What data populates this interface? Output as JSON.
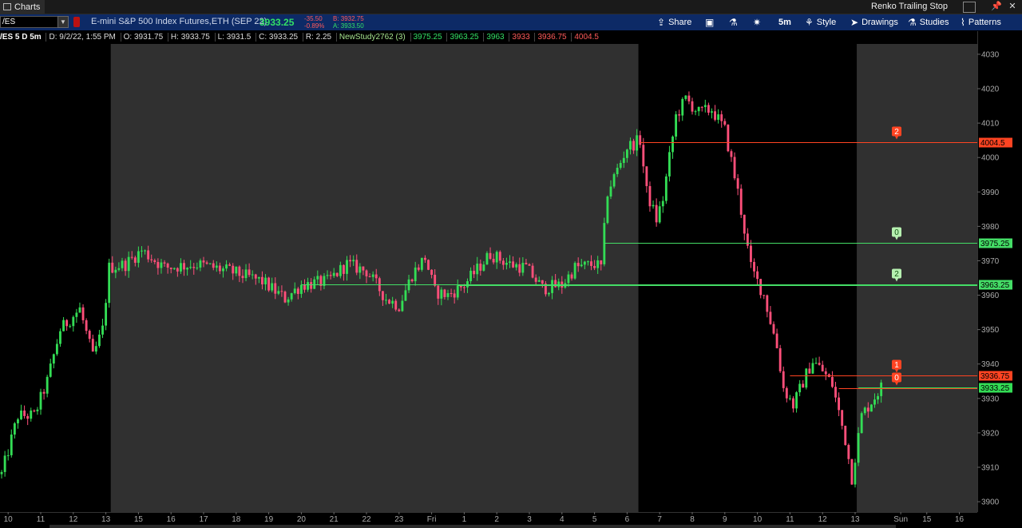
{
  "window": {
    "tab_label": "Charts",
    "right_title": "Renko Trailing Stop"
  },
  "toolbar": {
    "symbol": "/ES",
    "instrument_name": "E-mini S&P 500 Index Futures,ETH (SEP 22)",
    "last_price": "3933.25",
    "change": "-35.50",
    "change_pct": "-0.89%",
    "bid": "B: 3932.75",
    "ask": "A: 3933.50",
    "share_label": "Share",
    "timeframe_label": "5m",
    "style_label": "Style",
    "drawings_label": "Drawings",
    "studies_label": "Studies",
    "patterns_label": "Patterns"
  },
  "infobar": {
    "symbol_period": "/ES 5 D 5m",
    "date": "D: 9/2/22, 1:55 PM",
    "open": "O: 3931.75",
    "high": "H: 3933.75",
    "low": "L: 3931.5",
    "close": "C: 3933.25",
    "range": "R: 2.25",
    "study_name": "NewStudy2762 (3)",
    "study_values": [
      "3975.25",
      "3963.25",
      "3963",
      "3933",
      "3936.75",
      "4004.5"
    ]
  },
  "chart_data": {
    "type": "candlestick",
    "ylim": [
      3897,
      4033
    ],
    "y_ticks": [
      3900,
      3910,
      3920,
      3930,
      3940,
      3950,
      3960,
      3970,
      3980,
      3990,
      4000,
      4010,
      4020,
      4030
    ],
    "x_tick_labels": [
      {
        "label": "10",
        "i": 2
      },
      {
        "label": "11",
        "i": 12
      },
      {
        "label": "12",
        "i": 22
      },
      {
        "label": "13",
        "i": 32
      },
      {
        "label": "15",
        "i": 42
      },
      {
        "label": "16",
        "i": 52
      },
      {
        "label": "17",
        "i": 62
      },
      {
        "label": "18",
        "i": 72
      },
      {
        "label": "19",
        "i": 82
      },
      {
        "label": "20",
        "i": 92
      },
      {
        "label": "21",
        "i": 102
      },
      {
        "label": "22",
        "i": 112
      },
      {
        "label": "23",
        "i": 122
      },
      {
        "label": "Fri",
        "i": 132
      },
      {
        "label": "1",
        "i": 142
      },
      {
        "label": "2",
        "i": 152
      },
      {
        "label": "3",
        "i": 162
      },
      {
        "label": "4",
        "i": 172
      },
      {
        "label": "5",
        "i": 182
      },
      {
        "label": "6",
        "i": 192
      },
      {
        "label": "7",
        "i": 202
      },
      {
        "label": "8",
        "i": 212
      },
      {
        "label": "9",
        "i": 222
      },
      {
        "label": "10",
        "i": 232
      },
      {
        "label": "11",
        "i": 242
      },
      {
        "label": "12",
        "i": 252
      },
      {
        "label": "13",
        "i": 262
      },
      {
        "label": "Sun",
        "i": 276
      },
      {
        "label": "15",
        "i": 284
      },
      {
        "label": "16",
        "i": 294
      }
    ],
    "bar_count": 300,
    "last_bar_index": 270,
    "sessions": [
      {
        "from_index": 0,
        "to_index": 34,
        "shade": "dark"
      },
      {
        "from_index": 34,
        "to_index": 196,
        "shade": "light"
      },
      {
        "from_index": 196,
        "to_index": 263,
        "shade": "dark"
      },
      {
        "from_index": 263,
        "to_index": 300,
        "shade": "light"
      }
    ],
    "price_path": [
      {
        "i": 0,
        "p": 3908
      },
      {
        "i": 5,
        "p": 3925
      },
      {
        "i": 10,
        "p": 3925
      },
      {
        "i": 14,
        "p": 3935
      },
      {
        "i": 18,
        "p": 3950
      },
      {
        "i": 24,
        "p": 3956
      },
      {
        "i": 28,
        "p": 3942
      },
      {
        "i": 31,
        "p": 3950
      },
      {
        "i": 33,
        "p": 3968
      },
      {
        "i": 38,
        "p": 3969
      },
      {
        "i": 43,
        "p": 3973
      },
      {
        "i": 50,
        "p": 3968
      },
      {
        "i": 60,
        "p": 3969
      },
      {
        "i": 70,
        "p": 3967
      },
      {
        "i": 80,
        "p": 3964
      },
      {
        "i": 87,
        "p": 3959
      },
      {
        "i": 92,
        "p": 3963
      },
      {
        "i": 100,
        "p": 3964
      },
      {
        "i": 106,
        "p": 3969
      },
      {
        "i": 112,
        "p": 3967
      },
      {
        "i": 118,
        "p": 3959
      },
      {
        "i": 122,
        "p": 3957
      },
      {
        "i": 126,
        "p": 3966
      },
      {
        "i": 130,
        "p": 3971
      },
      {
        "i": 133,
        "p": 3961
      },
      {
        "i": 137,
        "p": 3960
      },
      {
        "i": 142,
        "p": 3963
      },
      {
        "i": 150,
        "p": 3972
      },
      {
        "i": 156,
        "p": 3969
      },
      {
        "i": 161,
        "p": 3968
      },
      {
        "i": 166,
        "p": 3962
      },
      {
        "i": 172,
        "p": 3963
      },
      {
        "i": 176,
        "p": 3968
      },
      {
        "i": 182,
        "p": 3969
      },
      {
        "i": 184,
        "p": 3968
      },
      {
        "i": 186,
        "p": 3990
      },
      {
        "i": 192,
        "p": 4003
      },
      {
        "i": 196,
        "p": 4005
      },
      {
        "i": 198,
        "p": 3990
      },
      {
        "i": 201,
        "p": 3982
      },
      {
        "i": 203,
        "p": 3988
      },
      {
        "i": 207,
        "p": 4012
      },
      {
        "i": 210,
        "p": 4017
      },
      {
        "i": 214,
        "p": 4013
      },
      {
        "i": 218,
        "p": 4014
      },
      {
        "i": 222,
        "p": 4008
      },
      {
        "i": 226,
        "p": 3990
      },
      {
        "i": 230,
        "p": 3968
      },
      {
        "i": 234,
        "p": 3960
      },
      {
        "i": 238,
        "p": 3945
      },
      {
        "i": 240,
        "p": 3933
      },
      {
        "i": 243,
        "p": 3928
      },
      {
        "i": 247,
        "p": 3937
      },
      {
        "i": 249,
        "p": 3941
      },
      {
        "i": 252,
        "p": 3938
      },
      {
        "i": 255,
        "p": 3934
      },
      {
        "i": 259,
        "p": 3918
      },
      {
        "i": 261,
        "p": 3907
      },
      {
        "i": 264,
        "p": 3925
      },
      {
        "i": 270,
        "p": 3933.25
      }
    ],
    "horizontal_lines": [
      {
        "price": 4004.5,
        "label": "4004.5",
        "color": "#ff4422",
        "marker": "2",
        "from_index": 196,
        "marker_fill": "#ff4422"
      },
      {
        "price": 3975.25,
        "label": "3975.25",
        "color": "#44dd66",
        "marker": "0",
        "from_index": 185,
        "marker_fill": "#b6f0b0"
      },
      {
        "price": 3963.25,
        "label": "3963.25",
        "color": "#44dd66",
        "marker": "2",
        "from_index": 92,
        "marker_fill": "#b6f0b0"
      },
      {
        "price": 3963,
        "label": "",
        "color": "#44dd66",
        "marker": "",
        "from_index": 140,
        "marker_fill": ""
      },
      {
        "price": 3936.75,
        "label": "3936.75",
        "color": "#ff4422",
        "marker": "1",
        "from_index": 242,
        "marker_fill": "#ff4422"
      },
      {
        "price": 3933,
        "label": "",
        "color": "#ff4422",
        "marker": "0",
        "from_index": 257,
        "marker_fill": "#ff4422"
      },
      {
        "price": 3933.25,
        "label": "3933.25",
        "color": "#33dd55",
        "marker": "",
        "from_index": 263,
        "marker_fill": ""
      }
    ]
  },
  "colors": {
    "up": "#33dd55",
    "down": "#ff4f7a",
    "dark_session": "#000000",
    "light_session": "#303030",
    "axis_text": "#aaaaaa",
    "toolbar_bg": "#0d2a66"
  }
}
